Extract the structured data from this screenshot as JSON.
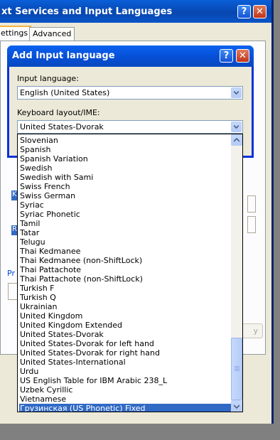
{
  "background_window": {
    "title": "xt Services and Input Languages",
    "help_glyph": "?",
    "close_glyph": "✕",
    "tabs": [
      "ettings",
      "Advanced"
    ],
    "preferences_fragment": "Pr",
    "apply_fragment": "y",
    "side_letters": [
      "K",
      "R"
    ]
  },
  "dialog": {
    "title": "Add Input language",
    "help_glyph": "?",
    "close_glyph": "✕",
    "input_language_label": "Input language:",
    "input_language_value": "English (United States)",
    "keyboard_label": "Keyboard layout/IME:",
    "keyboard_value": "United States-Dvorak"
  },
  "dropdown": {
    "items": [
      "Slovenian",
      "Spanish",
      "Spanish Variation",
      "Swedish",
      "Swedish with Sami",
      "Swiss French",
      "Swiss German",
      "Syriac",
      "Syriac Phonetic",
      "Tamil",
      "Tatar",
      "Telugu",
      "Thai Kedmanee",
      "Thai Kedmanee (non-ShiftLock)",
      "Thai Pattachote",
      "Thai Pattachote (non-ShiftLock)",
      "Turkish F",
      "Turkish Q",
      "Ukrainian",
      "United Kingdom",
      "United Kingdom Extended",
      "United States-Dvorak",
      "United States-Dvorak for left hand",
      "United States-Dvorak for right hand",
      "United States-International",
      "Urdu",
      "US English Table for IBM Arabic 238_L",
      "Uzbek Cyrillic",
      "Vietnamese",
      "Грузинская (US Phonetic) Fixed"
    ],
    "selected": "Грузинская (US Phonetic) Fixed",
    "scroll_position": 0.92
  },
  "colors": {
    "selection": "#316ac5",
    "title_bar": "#0a54c8",
    "dialog_face": "#ece9d8"
  }
}
